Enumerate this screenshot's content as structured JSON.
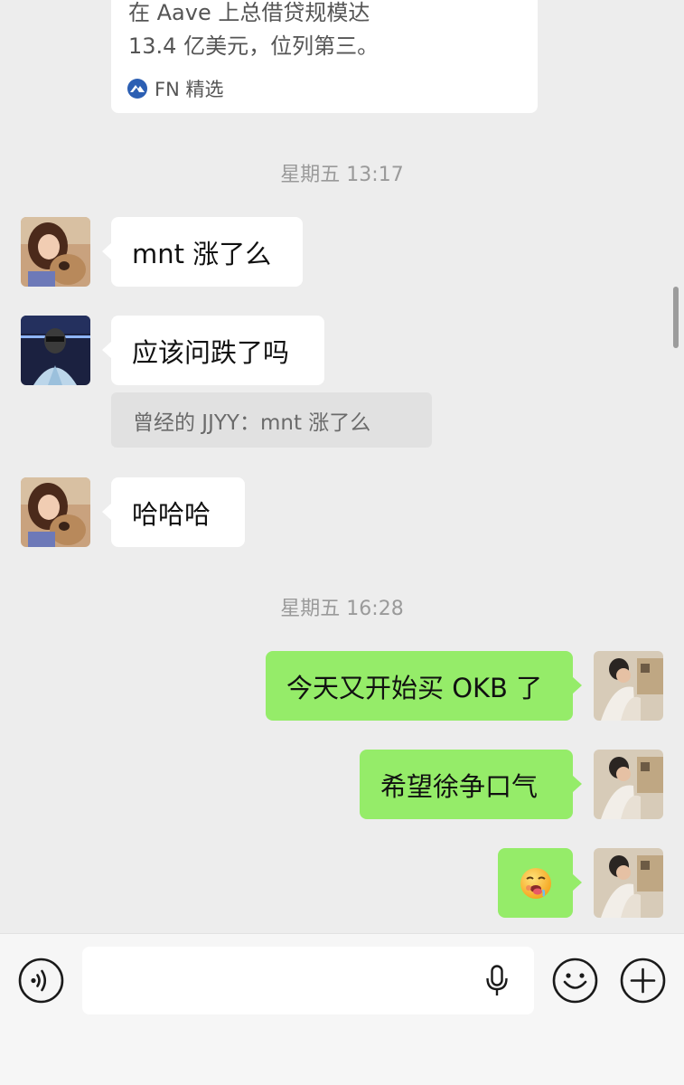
{
  "card": {
    "line1": "在 Aave 上总借贷规模达",
    "line2": "13.4 亿美元，位列第三。",
    "source": "FN 精选"
  },
  "timestamps": [
    "星期五 13:17",
    "星期五 16:28"
  ],
  "messages": [
    {
      "sender": "曾经的 JJYY",
      "text": "mnt 涨了么"
    },
    {
      "sender": "other",
      "text": "应该问跌了吗",
      "quote": "曾经的 JJYY：mnt 涨了么"
    },
    {
      "sender": "曾经的 JJYY",
      "text": "哈哈哈"
    },
    {
      "sender": "me",
      "text": "今天又开始买 OKB 了"
    },
    {
      "sender": "me",
      "text": "希望徐争口气"
    },
    {
      "sender": "me",
      "emoji": "drooling-face"
    }
  ],
  "input": {
    "value": "",
    "placeholder": ""
  },
  "icons": [
    "voice-mode-icon",
    "microphone-icon",
    "emoji-icon",
    "plus-icon",
    "fn-logo-icon"
  ],
  "colors": {
    "background": "#ededed",
    "bubble_self": "#95ec69",
    "bubble_other": "#ffffff",
    "timestamp": "#9a9a9a"
  }
}
